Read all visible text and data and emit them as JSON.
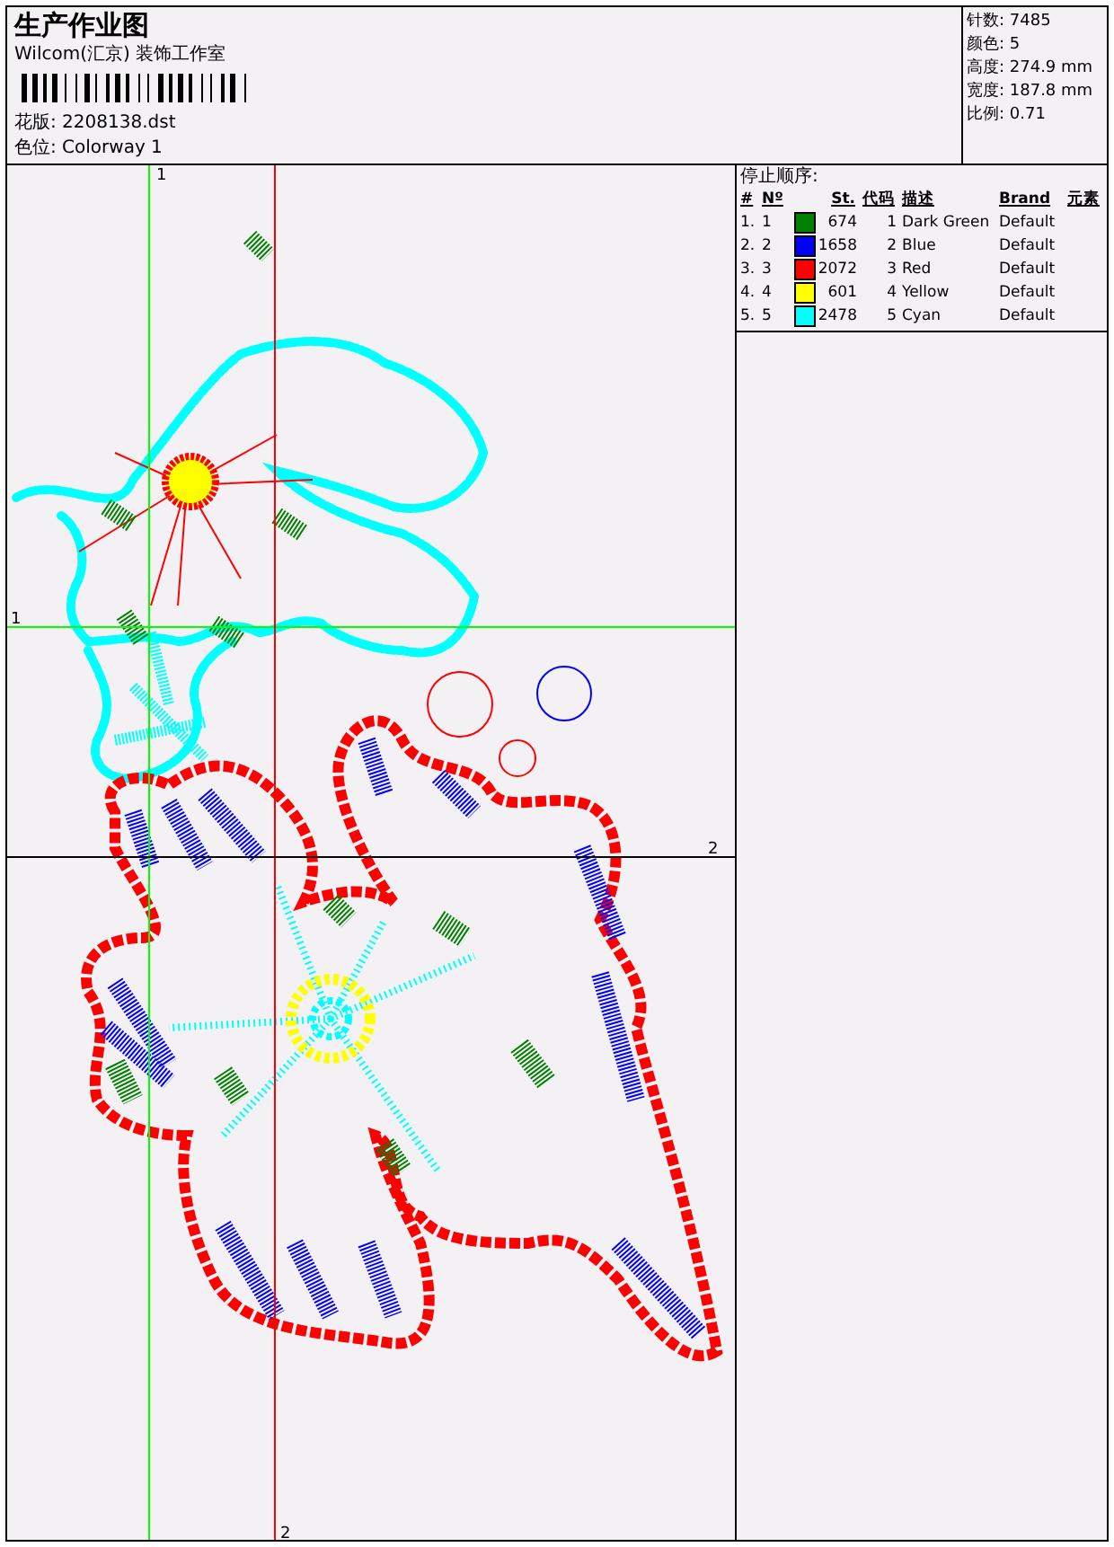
{
  "header": {
    "title": "生产作业图",
    "company": "Wilcom(汇京) 装饰工作室",
    "design_file": "花版: 2208138.dst",
    "colorway": "色位: Colorway 1"
  },
  "stats": [
    "针数: 7485",
    "颜色: 5",
    "高度: 274.9 mm",
    "宽度: 187.8 mm",
    "比例: 0.71"
  ],
  "guide_labels": [
    "1",
    "1",
    "2",
    "2"
  ],
  "stop_sequence": {
    "title": "停止顺序:",
    "columns": [
      "#",
      "Nº",
      "St.",
      "代码",
      "描述",
      "Brand",
      "元素"
    ],
    "rows": [
      {
        "index": "1.",
        "number": "1",
        "color": "#008000",
        "stitches": "674",
        "code": "1",
        "description": "Dark Green",
        "brand": "Default"
      },
      {
        "index": "2.",
        "number": "2",
        "color": "#0000ff",
        "stitches": "1658",
        "code": "2",
        "description": "Blue",
        "brand": "Default"
      },
      {
        "index": "3.",
        "number": "3",
        "color": "#ff0000",
        "stitches": "2072",
        "code": "3",
        "description": "Red",
        "brand": "Default"
      },
      {
        "index": "4.",
        "number": "4",
        "color": "#ffff00",
        "stitches": "601",
        "code": "4",
        "description": "Yellow",
        "brand": "Default"
      },
      {
        "index": "5.",
        "number": "5",
        "color": "#00ffff",
        "stitches": "2478",
        "code": "5",
        "description": "Cyan",
        "brand": "Default"
      }
    ]
  }
}
